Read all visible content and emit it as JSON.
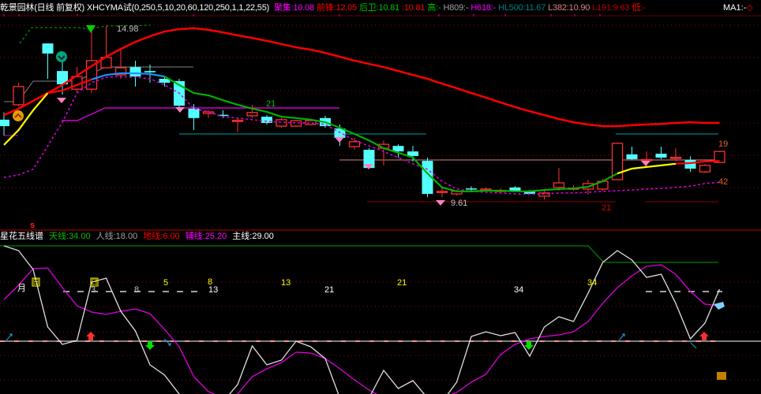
{
  "header": {
    "title": "乾景园林(日线 前复权)",
    "indicator": "XHCYMA试(0,250,5,10,20,60,120,250,1,1,22,55)",
    "fields": [
      {
        "label": "聚集:",
        "value": "10.08",
        "color": "#ff00ff"
      },
      {
        "label": "前锋:",
        "value": "12.05",
        "color": "#ff0000"
      },
      {
        "label": "后卫:",
        "value": "10.81",
        "color": "#00c000"
      },
      {
        "label": ":",
        "value": "10.81",
        "color": "#ff0000"
      },
      {
        "label": "高:",
        "value": "-",
        "color": "#00c000"
      },
      {
        "label": "H809:",
        "value": "-",
        "color": "#a0a0a0"
      },
      {
        "label": "H618:",
        "value": "-",
        "color": "#ff00ff"
      },
      {
        "label": "HL500:",
        "value": "11.67",
        "color": "#008080"
      },
      {
        "label": "L382:",
        "value": "10.90",
        "color": "#e08080"
      },
      {
        "label": "L191:",
        "value": "9.63",
        "color": "#c00000"
      },
      {
        "label": "低:",
        "value": "-",
        "color": "#ff0000"
      }
    ],
    "ma1": {
      "label": "MA1:",
      "value": "-",
      "color": "#ffffff"
    }
  },
  "lower_header": {
    "title": "星花五线谱",
    "fields": [
      {
        "label": "天线:",
        "value": "34.00",
        "color": "#00c000"
      },
      {
        "label": "人线:",
        "value": "18.00",
        "color": "#a0a0a0"
      },
      {
        "label": "地线:",
        "value": "6.00",
        "color": "#ff0000"
      },
      {
        "label": "辅线:",
        "value": "25.20",
        "color": "#ff00ff"
      },
      {
        "label": "主线:",
        "value": "29.00",
        "color": "#ffffff"
      }
    ],
    "marker": "s"
  },
  "upper_labels": {
    "high_price": "14.98",
    "low_price": "9.61",
    "count_green": "21",
    "count_red": "21",
    "right_top": "19",
    "right_bottom": "42"
  },
  "lower_labels": {
    "month": "月",
    "day_box_1": "日",
    "day_box_2": "日",
    "white_nums": [
      "3",
      "8",
      "13",
      "21",
      "34"
    ],
    "yellow_nums": [
      "5",
      "8",
      "13",
      "21",
      "34"
    ]
  },
  "colors": {
    "up": "#ff3030",
    "down": "#54ffff",
    "grid": "#a00000",
    "bg": "#000000"
  },
  "chart_data": {
    "type": "candlestick",
    "price_range": [
      9.61,
      14.98
    ],
    "candles_ohlc": [
      [
        12.19,
        12.41,
        11.7,
        11.99
      ],
      [
        12.65,
        13.33,
        12.6,
        13.21
      ],
      null,
      [
        14.54,
        14.54,
        13.45,
        14.23
      ],
      [
        13.69,
        14.06,
        12.96,
        13.28
      ],
      [
        13.13,
        13.81,
        13.04,
        13.52
      ],
      [
        13.13,
        14.98,
        13.01,
        14.01
      ],
      [
        13.79,
        15.08,
        13.79,
        14.11
      ],
      [
        13.57,
        14.35,
        13.45,
        13.79
      ],
      [
        13.81,
        14.01,
        13.21,
        13.52
      ],
      [
        13.69,
        13.89,
        13.33,
        13.65
      ],
      [
        13.45,
        13.52,
        13.21,
        13.33
      ],
      [
        13.38,
        13.45,
        12.48,
        12.62
      ],
      [
        12.53,
        12.67,
        11.87,
        12.24
      ],
      [
        12.38,
        12.48,
        12.24,
        12.43
      ],
      [
        12.34,
        12.48,
        12.24,
        12.31
      ],
      [
        12.14,
        12.24,
        11.8,
        12.17
      ],
      [
        12.31,
        12.65,
        12.24,
        12.41
      ],
      [
        12.28,
        12.33,
        12.04,
        12.09
      ],
      [
        11.99,
        12.24,
        11.94,
        12.19
      ],
      [
        11.99,
        12.19,
        11.96,
        12.16
      ],
      [
        12.04,
        12.19,
        12.02,
        12.16
      ],
      [
        12.24,
        12.31,
        11.94,
        11.99
      ],
      [
        11.92,
        12.04,
        11.38,
        11.63
      ],
      [
        11.36,
        11.63,
        11.26,
        11.51
      ],
      [
        11.26,
        11.31,
        10.68,
        10.7
      ],
      [
        11.31,
        11.55,
        10.78,
        11.43
      ],
      [
        11.38,
        11.43,
        11.02,
        11.21
      ],
      [
        11.21,
        11.38,
        10.9,
        11.07
      ],
      [
        10.92,
        11.02,
        9.8,
        9.9
      ],
      [
        9.96,
        10.1,
        9.8,
        9.98
      ],
      [
        9.9,
        10.02,
        9.85,
        9.98
      ],
      [
        10.07,
        10.14,
        9.95,
        10.04
      ],
      [
        10.03,
        10.1,
        9.98,
        10.05
      ],
      [
        9.99,
        10.07,
        9.95,
        10.01
      ],
      [
        10.1,
        10.14,
        9.98,
        10.0
      ],
      [
        10.0,
        10.02,
        9.88,
        9.9
      ],
      [
        9.83,
        10.0,
        9.73,
        9.93
      ],
      [
        10.1,
        10.7,
        10.0,
        10.24
      ],
      [
        10.06,
        10.17,
        10.0,
        10.08
      ],
      [
        10.05,
        10.34,
        9.88,
        10.22
      ],
      [
        10.05,
        10.36,
        10.0,
        10.29
      ],
      [
        10.34,
        11.48,
        10.32,
        11.46
      ],
      [
        11.12,
        11.36,
        10.95,
        10.97
      ],
      [
        10.93,
        11.21,
        10.7,
        10.96
      ],
      [
        11.14,
        11.36,
        10.97,
        11.02
      ],
      [
        11.01,
        11.31,
        10.9,
        11.03
      ],
      [
        10.95,
        11.06,
        10.58,
        10.68
      ],
      [
        10.58,
        10.82,
        10.55,
        10.78
      ],
      [
        10.87,
        11.21,
        10.87,
        11.21
      ]
    ],
    "ma_long": [
      12.33,
      12.53,
      12.77,
      13.01,
      13.26,
      13.55,
      13.84,
      14.13,
      14.37,
      14.59,
      14.76,
      14.91,
      14.98,
      15.01,
      14.96,
      14.88,
      14.79,
      14.71,
      14.62,
      14.52,
      14.42,
      14.35,
      14.25,
      14.13,
      14.01,
      13.91,
      13.81,
      13.69,
      13.57,
      13.45,
      13.3,
      13.16,
      13.01,
      12.87,
      12.72,
      12.58,
      12.45,
      12.33,
      12.21,
      12.11,
      12.04,
      11.99,
      11.99,
      12.02,
      12.04,
      12.06,
      12.09,
      12.11,
      12.09,
      12.09
    ],
    "ma_short": [
      11.41,
      11.87,
      12.48,
      13.01,
      13.09,
      13.26,
      13.43,
      13.57,
      13.62,
      13.62,
      13.6,
      13.52,
      13.26,
      13.01,
      12.94,
      12.79,
      12.65,
      12.53,
      12.43,
      12.28,
      12.24,
      12.19,
      12.11,
      11.94,
      11.75,
      11.55,
      11.31,
      11.17,
      11.02,
      10.53,
      10.1,
      9.98,
      9.98,
      10.0,
      10.0,
      9.98,
      9.98,
      10.02,
      10.05,
      10.07,
      10.12,
      10.29,
      10.53,
      10.68,
      10.73,
      10.78,
      10.83,
      10.85,
      10.9,
      10.92
    ],
    "ma_short_colors": [
      [
        "#ffff00",
        0,
        3
      ],
      [
        "#ff0000",
        3,
        6
      ],
      [
        "#2090ff",
        6,
        11
      ],
      [
        "#00b000",
        11,
        42
      ],
      [
        "#ffff00",
        42,
        46
      ],
      [
        "#ff0000",
        46,
        49
      ]
    ],
    "ma_dotted": [
      10.41,
      10.49,
      10.66,
      11.38,
      12.11,
      13.01,
      13.33,
      13.5,
      13.52,
      13.5,
      13.45,
      13.26,
      13.01,
      12.53,
      12.43,
      12.28,
      12.24,
      12.19,
      12.14,
      12.11,
      12.09,
      12.09,
      12.04,
      11.8,
      11.55,
      11.38,
      11.21,
      11.02,
      10.83,
      10.66,
      10.29,
      10.05,
      9.98,
      9.95,
      9.93,
      9.9,
      9.9,
      9.9,
      9.93,
      9.93,
      9.95,
      9.98,
      10.0,
      10.02,
      10.05,
      10.07,
      10.1,
      10.14,
      10.22,
      10.26
    ],
    "lower_white": [
      94,
      91,
      79,
      42.5,
      31.5,
      34,
      71,
      73.5,
      52.5,
      40,
      18.5,
      12,
      0,
      -7.5,
      -10,
      -5,
      6,
      30.5,
      18.5,
      21.5,
      33.5,
      30,
      22.5,
      -2.5,
      -7.5,
      -2.5,
      15,
      3.5,
      8.5,
      -2.5,
      -5,
      7.5,
      36.5,
      39.5,
      37,
      39,
      24,
      42.5,
      49,
      46,
      64,
      83.5,
      91,
      85,
      74,
      76,
      57.5,
      35,
      45,
      66.5
    ],
    "lower_magenta": [
      60,
      69,
      79.5,
      80,
      67.5,
      56,
      52,
      50.5,
      52.5,
      54,
      51,
      41,
      30,
      11,
      1.5,
      -2.5,
      0,
      11,
      16,
      20,
      26.5,
      26,
      22.5,
      16,
      9,
      2.5,
      -2.5,
      -5,
      -5,
      -5,
      -2.5,
      1,
      7.5,
      12.5,
      25,
      31.5,
      35,
      36.5,
      37.5,
      39.5,
      46,
      57.5,
      67.5,
      75,
      81,
      82,
      76,
      65,
      57,
      56
    ]
  }
}
